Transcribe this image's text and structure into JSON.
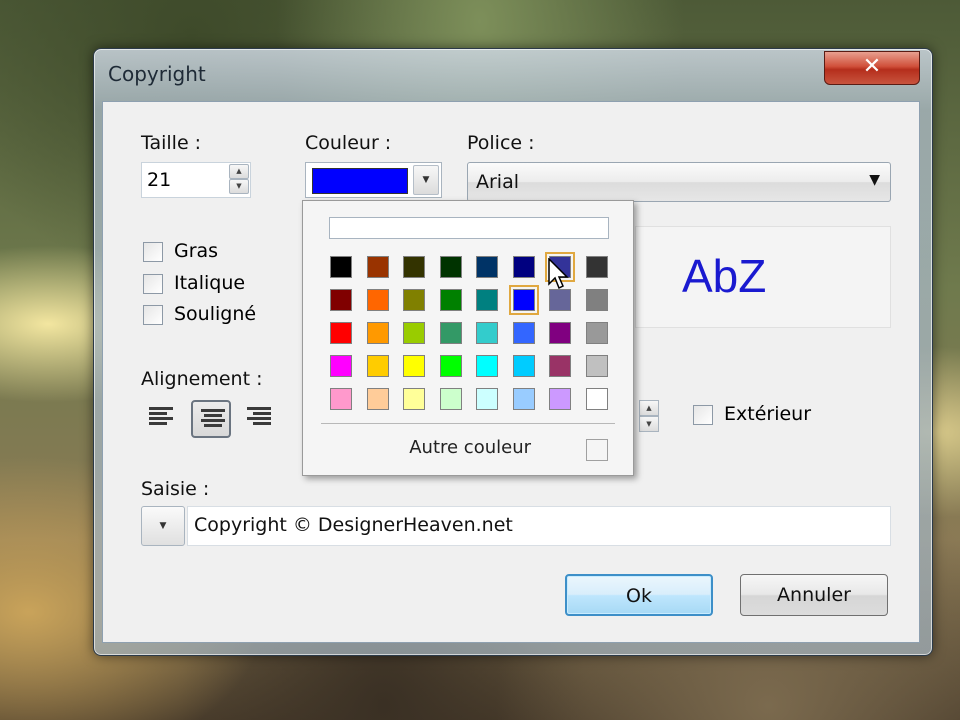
{
  "window": {
    "title": "Copyright",
    "close_glyph": "✕"
  },
  "form": {
    "size_label": "Taille :",
    "size_value": "21",
    "color_label": "Couleur :",
    "color_value": "#0000ff",
    "font_label": "Police :",
    "font_value": "Arial",
    "bold_label": "Gras",
    "italic_label": "Italique",
    "underline_label": "Souligné",
    "alignment_label": "Alignement :",
    "alignment_selected": "center",
    "exterior_label": "Extérieur",
    "preview_text": "AbZ",
    "input_label": "Saisie :",
    "input_value": "Copyright © DesignerHeaven.net"
  },
  "buttons": {
    "ok_label": "Ok",
    "cancel_label": "Annuler"
  },
  "color_popup": {
    "other_color_label": "Autre couleur",
    "selected": "#0000ff",
    "hovered": "#333399",
    "palette": [
      [
        "#000000",
        "#993300",
        "#333300",
        "#003300",
        "#003366",
        "#000080",
        "#333399",
        "#333333"
      ],
      [
        "#800000",
        "#ff6600",
        "#808000",
        "#008000",
        "#008080",
        "#0000ff",
        "#666699",
        "#808080"
      ],
      [
        "#ff0000",
        "#ff9900",
        "#99cc00",
        "#339966",
        "#33cccc",
        "#3366ff",
        "#800080",
        "#999999"
      ],
      [
        "#ff00ff",
        "#ffcc00",
        "#ffff00",
        "#00ff00",
        "#00ffff",
        "#00ccff",
        "#993366",
        "#c0c0c0"
      ],
      [
        "#ff99cc",
        "#ffcc99",
        "#ffff99",
        "#ccffcc",
        "#ccffff",
        "#99ccff",
        "#cc99ff",
        "#ffffff"
      ]
    ]
  }
}
